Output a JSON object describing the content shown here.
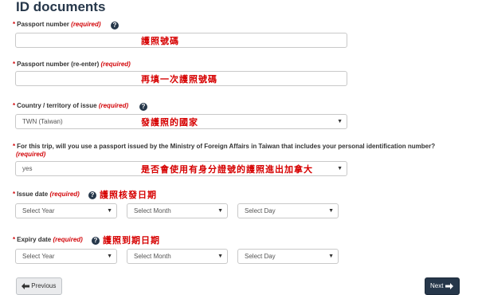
{
  "page": {
    "title": "ID documents"
  },
  "fields": {
    "passport": {
      "label": "Passport number",
      "required": "(required)",
      "value": "",
      "annotation": "護照號碼"
    },
    "passport_reenter": {
      "label": "Passport number (re-enter)",
      "required": "(required)",
      "value": "",
      "annotation": "再填一次護照號碼"
    },
    "country": {
      "label": "Country / territory of issue",
      "required": "(required)",
      "value": "TWN (Taiwan)",
      "annotation": "發護照的國家"
    },
    "mofa": {
      "label": "For this trip, will you use a passport issued by the Ministry of Foreign Affairs in Taiwan that includes your personal identification number?",
      "required": "(required)",
      "value": "yes",
      "annotation": "是否會使用有身分證號的護照進出加拿大"
    },
    "issue_date": {
      "label": "Issue date",
      "required": "(required)",
      "annotation": "護照核發日期",
      "year": "Select Year",
      "month": "Select Month",
      "day": "Select Day"
    },
    "expiry_date": {
      "label": "Expiry date",
      "required": "(required)",
      "annotation": "護照到期日期",
      "year": "Select Year",
      "month": "Select Month",
      "day": "Select Day"
    }
  },
  "buttons": {
    "previous": "Previous",
    "next": "Next"
  },
  "symbols": {
    "required_star": "*",
    "help_glyph": "?",
    "caret": "▼"
  },
  "icons": {
    "help": "question-circle-icon",
    "prev": "arrow-left-icon",
    "next": "arrow-right-icon"
  },
  "colors": {
    "accent": "#26374a",
    "required": "#d3080c",
    "annotation": "#d60000"
  }
}
